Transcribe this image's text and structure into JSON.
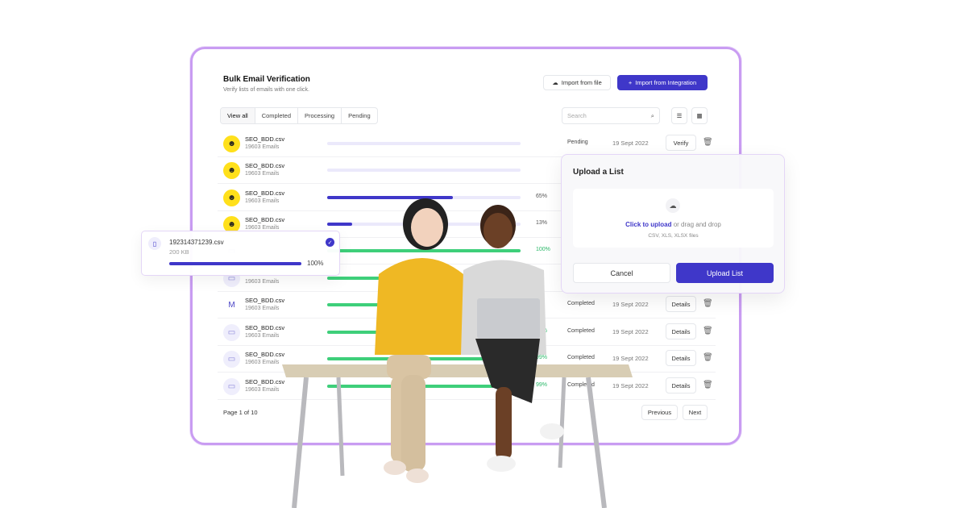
{
  "header": {
    "title": "Bulk Email Verification",
    "subtitle": "Verify lists of emails with one click.",
    "import_file": "Import from file",
    "import_integration": "Import from Integration"
  },
  "tabs": [
    "View all",
    "Completed",
    "Processing",
    "Pending"
  ],
  "search": {
    "placeholder": "Search"
  },
  "colors": {
    "accent": "#3f37c9",
    "success": "#3ecf7a",
    "track": "#ebe9fb",
    "frame": "#c99cf2"
  },
  "rows": [
    {
      "icon": "mailchimp-icon",
      "name": "SEO_BDD.csv",
      "count": "19603 Emails",
      "progress": 0,
      "pct": "",
      "status": "Pending",
      "date": "19 Sept 2022",
      "action": "Verify"
    },
    {
      "icon": "mailchimp-icon",
      "name": "SEO_BDD.csv",
      "count": "19603 Emails",
      "progress": 0,
      "pct": "",
      "status": "",
      "date": "",
      "action": ""
    },
    {
      "icon": "mailchimp-icon",
      "name": "SEO_BDD.csv",
      "count": "19603 Emails",
      "progress": 65,
      "pct": "65%",
      "status": "",
      "date": "",
      "action": ""
    },
    {
      "icon": "mailchimp-icon",
      "name": "SEO_BDD.csv",
      "count": "19603 Emails",
      "progress": 13,
      "pct": "13%",
      "status": "",
      "date": "",
      "action": ""
    },
    {
      "icon": "file-icon",
      "name": "",
      "count": "",
      "progress": 100,
      "pct": "100%",
      "status": "",
      "date": "",
      "action": ""
    },
    {
      "icon": "file-icon",
      "name": "",
      "count": "19603 Emails",
      "progress": 100,
      "pct": "",
      "status": "",
      "date": "",
      "action": ""
    },
    {
      "icon": "gmail-icon",
      "name": "SEO_BDD.csv",
      "count": "19603 Emails",
      "progress": 100,
      "pct": "",
      "status": "Completed",
      "date": "19 Sept 2022",
      "action": "Details"
    },
    {
      "icon": "file-icon",
      "name": "SEO_BDD.csv",
      "count": "19603 Emails",
      "progress": 100,
      "pct": "00%",
      "status": "Completed",
      "date": "19 Sept 2022",
      "action": "Details"
    },
    {
      "icon": "file-icon",
      "name": "SEO_BDD.csv",
      "count": "19603 Emails",
      "progress": 99,
      "pct": "99%",
      "status": "Completed",
      "date": "19 Sept 2022",
      "action": "Details"
    },
    {
      "icon": "file-icon",
      "name": "SEO_BDD.csv",
      "count": "19603 Emails",
      "progress": 99,
      "pct": "99%",
      "status": "Completed",
      "date": "19 Sept 2022",
      "action": "Details"
    }
  ],
  "pagination": {
    "label": "Page 1 of 10",
    "previous": "Previous",
    "next": "Next"
  },
  "upload_modal": {
    "title": "Upload a List",
    "click": "Click to upload",
    "drag": " or drag and drop",
    "types": "CSV, XLS, XLSX files",
    "cancel": "Cancel",
    "upload": "Upload List"
  },
  "file_card": {
    "name": "192314371239.csv",
    "size": "200 KB",
    "progress": 100,
    "pct": "100%"
  }
}
